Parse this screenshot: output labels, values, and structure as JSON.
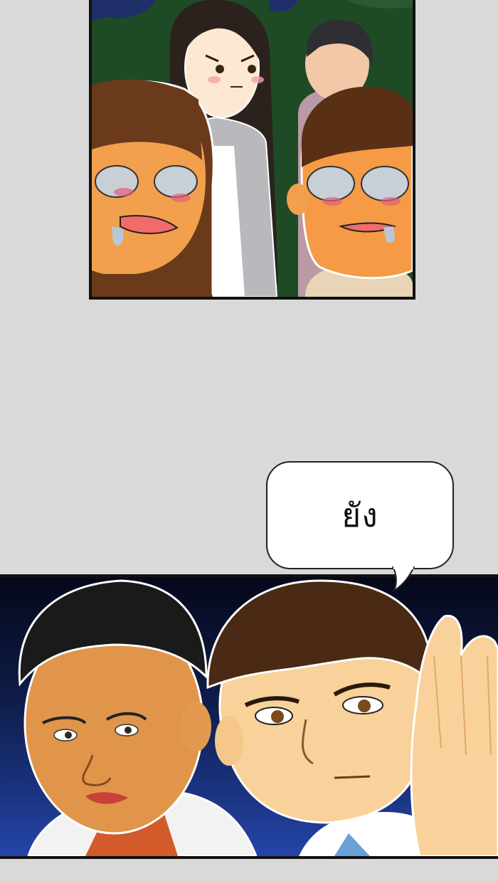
{
  "speech_bubble": {
    "text": "ยัง"
  },
  "colors": {
    "page_background": "#d9d9d9",
    "panel_border": "#111111",
    "bubble_fill": "#ffffff",
    "night_sky": "#0e1d4a"
  }
}
